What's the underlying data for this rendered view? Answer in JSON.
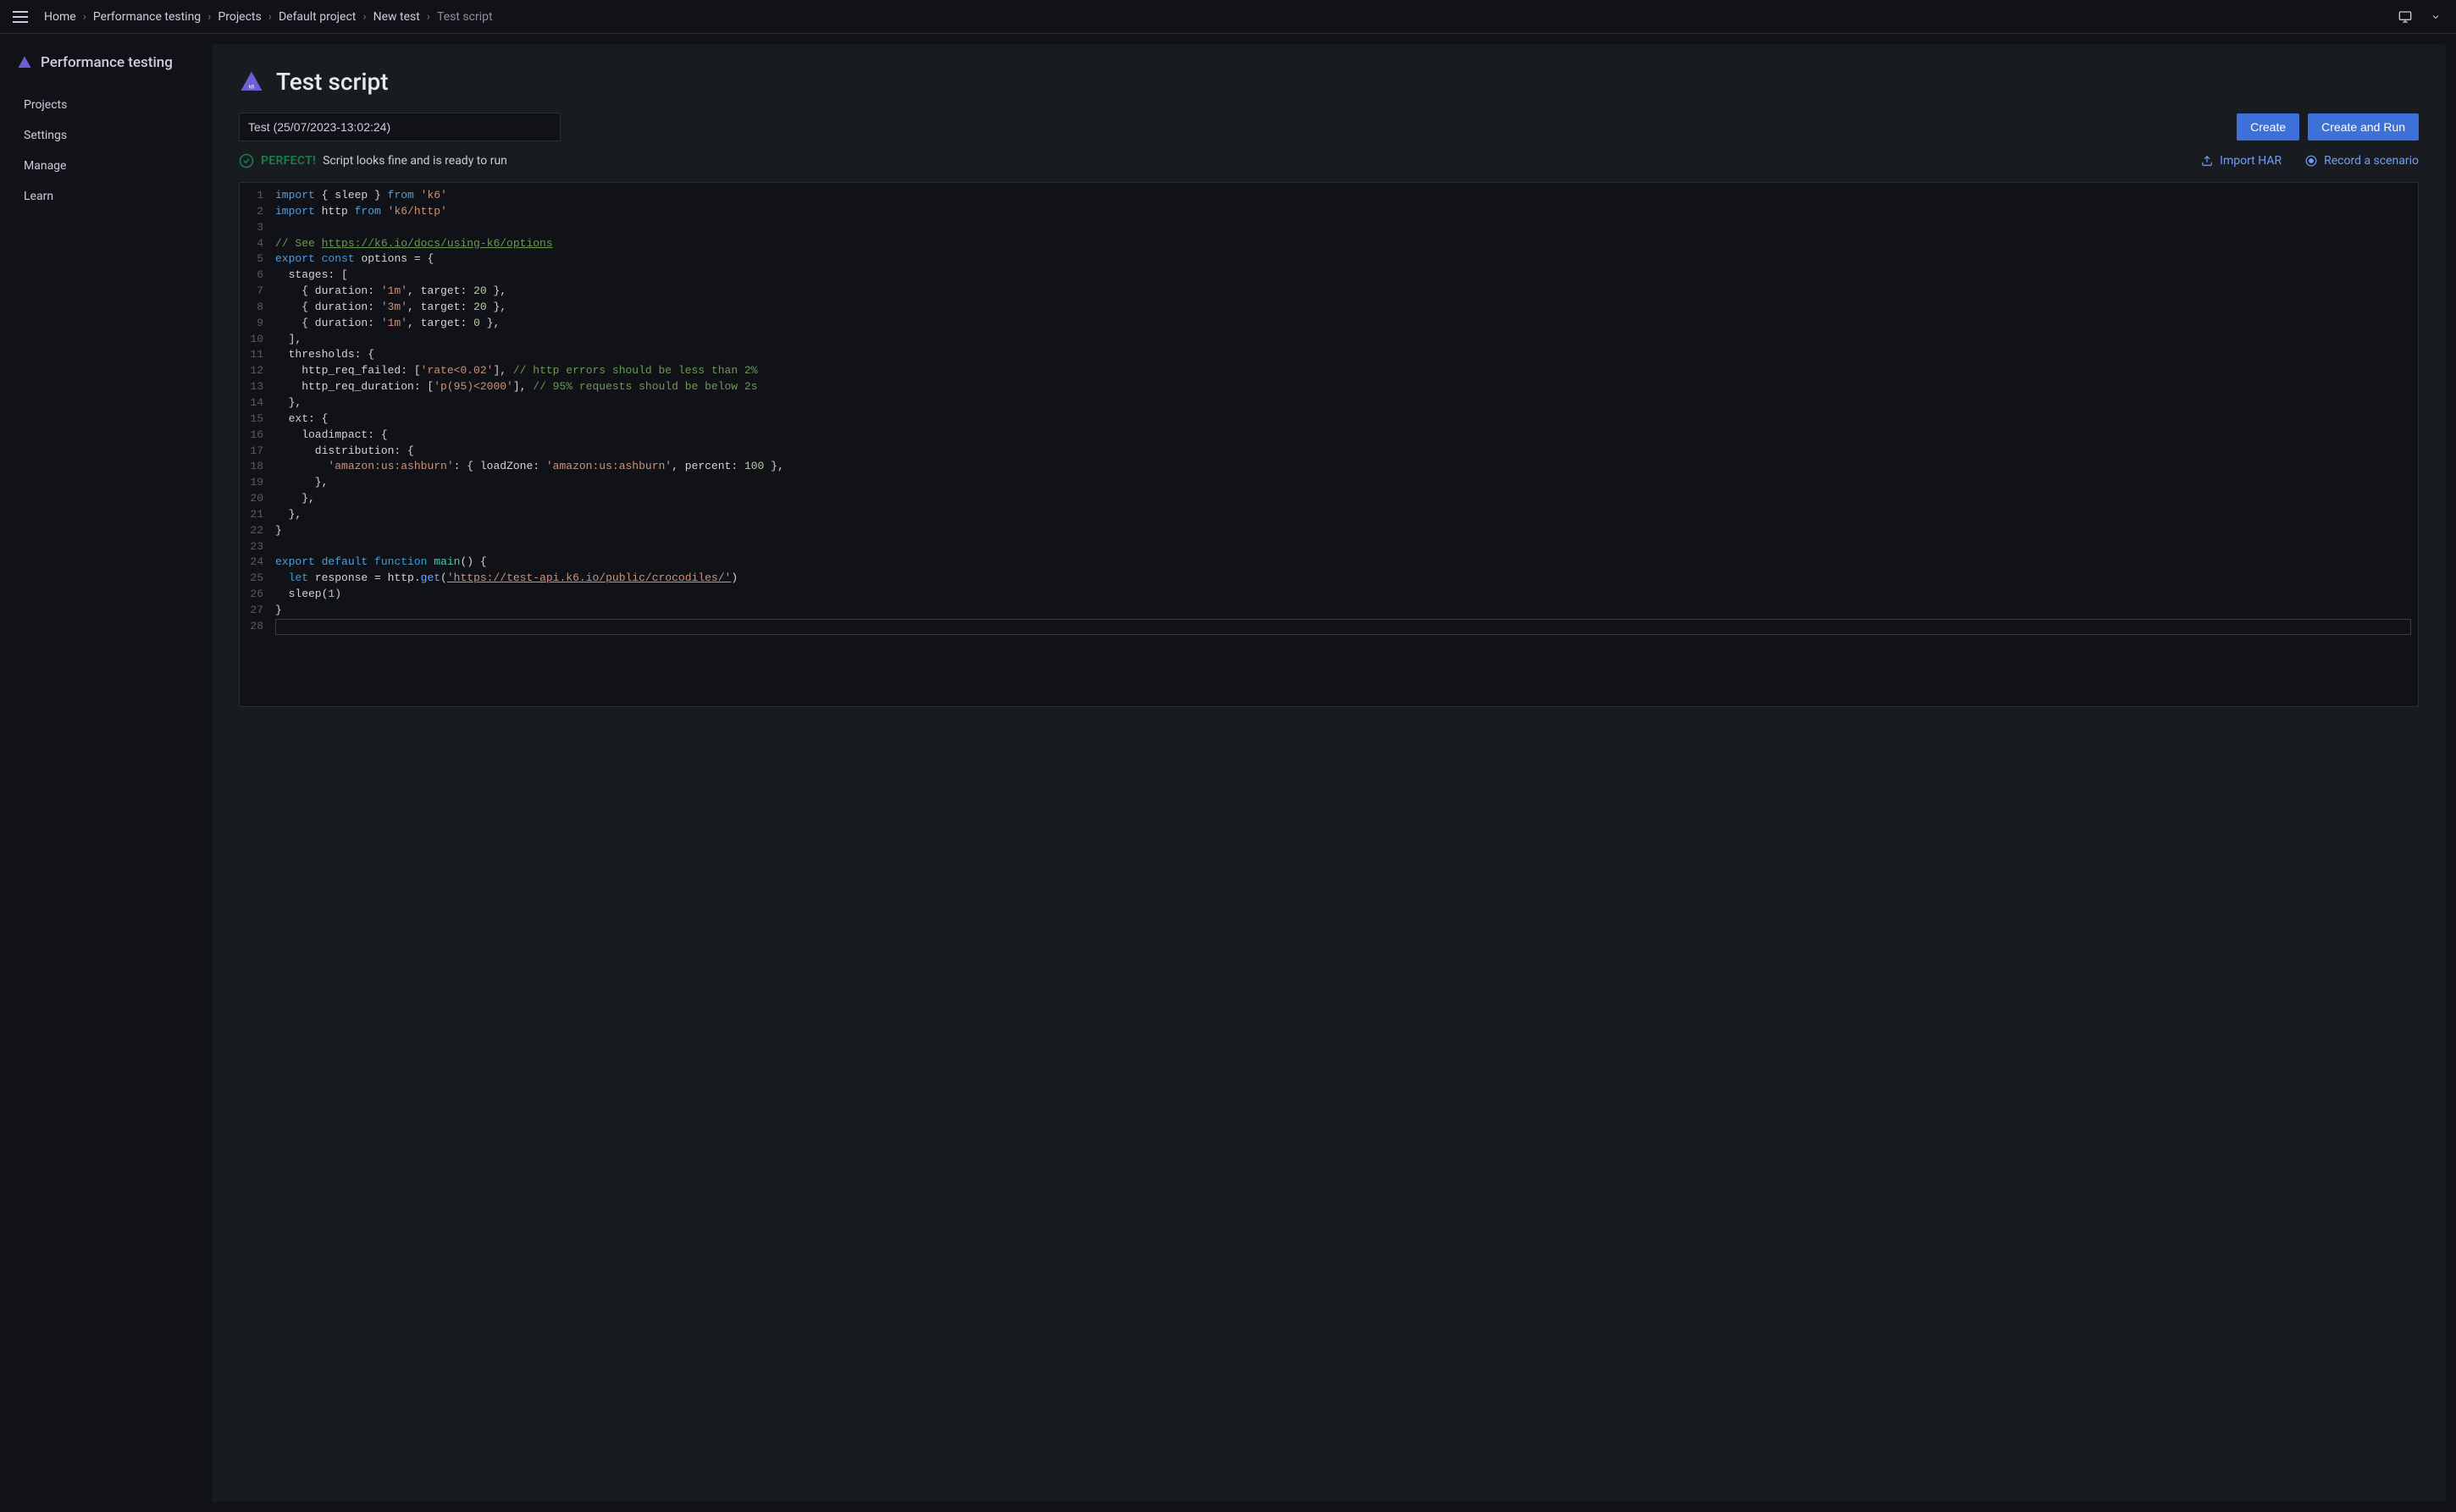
{
  "breadcrumb": {
    "items": [
      "Home",
      "Performance testing",
      "Projects",
      "Default project",
      "New test",
      "Test script"
    ]
  },
  "sidebar": {
    "title": "Performance testing",
    "items": [
      "Projects",
      "Settings",
      "Manage",
      "Learn"
    ]
  },
  "page": {
    "title": "Test script"
  },
  "form": {
    "test_name": "Test (25/07/2023-13:02:24)"
  },
  "buttons": {
    "create": "Create",
    "create_run": "Create and Run",
    "import_har": "Import HAR",
    "record": "Record a scenario"
  },
  "status": {
    "label": "PERFECT!",
    "text": "Script looks fine and is ready to run"
  },
  "code": {
    "comment_options": "// See ",
    "options_url": "https://k6.io/docs/using-k6/options",
    "comment_errors": "// http errors should be less than 2%",
    "comment_p95": "// 95% requests should be below 2s",
    "rate_threshold": "'rate<0.02'",
    "p95_threshold": "'p(95)<2000'",
    "crocodiles_url": "'https://test-api.k6.io/public/crocodiles/'",
    "load_zone": "'amazon:us:ashburn'",
    "percent": "100",
    "stage1_dur": "'1m'",
    "stage1_tgt": "20",
    "stage2_dur": "'3m'",
    "stage2_tgt": "20",
    "stage3_dur": "'1m'",
    "stage3_tgt": "0",
    "k6_mod": "'k6'",
    "k6_http_mod": "'k6/http'"
  }
}
